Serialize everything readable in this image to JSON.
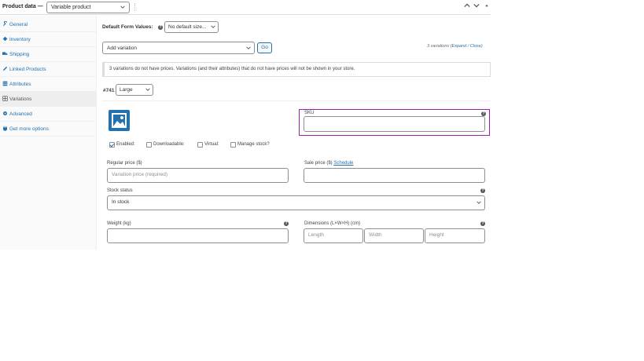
{
  "header": {
    "title": "Product data —",
    "product_type": "Variable product",
    "colors": {
      "link": "#2271b1",
      "highlight": "#9b1fa8"
    }
  },
  "sidebar": {
    "items": [
      {
        "label": "General",
        "icon": "wrench-icon"
      },
      {
        "label": "Inventory",
        "icon": "diamond-tag-icon"
      },
      {
        "label": "Shipping",
        "icon": "truck-icon"
      },
      {
        "label": "Linked Products",
        "icon": "link-icon"
      },
      {
        "label": "Attributes",
        "icon": "table-icon"
      },
      {
        "label": "Variations",
        "icon": "grid-icon",
        "active": true
      },
      {
        "label": "Advanced",
        "icon": "gear-icon"
      },
      {
        "label": "Get more options",
        "icon": "plugin-icon"
      }
    ]
  },
  "defaults": {
    "label": "Default Form Values:",
    "select": "No default size..."
  },
  "add_variation": {
    "select": "Add variation",
    "go": "Go",
    "count": "3 variations",
    "expand": "Expand",
    "sep": "/",
    "close": "Close"
  },
  "notice": "3 variations do not have prices. Variations (and their attributes) that do not have prices will not be shown in your store.",
  "variation": {
    "id": "#741",
    "size": "Large",
    "sku_label": "SKU",
    "sku_value": "",
    "enabled": "Enabled:",
    "downloadable": "Downloadable:",
    "virtual": "Virtual:",
    "manage_stock": "Manage stock?",
    "regular_price_label": "Regular price ($)",
    "regular_price_placeholder": "Variation price (required)",
    "sale_price_label": "Sale price ($)",
    "schedule": "Schedule",
    "stock_status_label": "Stock status",
    "stock_status": "In stock",
    "weight_label": "Weight (kg)",
    "dimensions_label": "Dimensions (L×W×H) (cm)",
    "length": "Length",
    "width": "Width",
    "height": "Height"
  }
}
